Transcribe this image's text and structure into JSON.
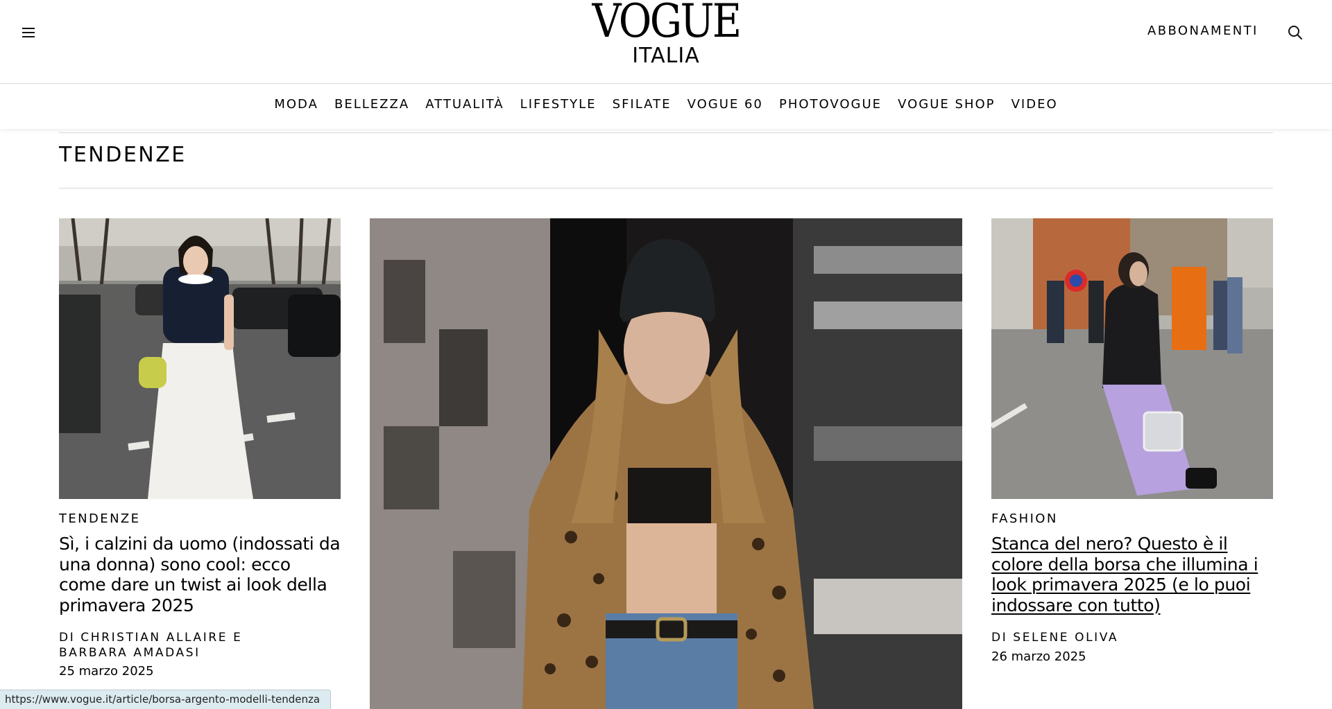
{
  "header": {
    "logo_primary": "VOGUE",
    "logo_secondary": "ITALIA",
    "subscribe_label": "ABBONAMENTI",
    "menu_icon": "hamburger-menu-icon",
    "search_icon": "search-icon"
  },
  "nav": {
    "items": [
      "MODA",
      "BELLEZZA",
      "ATTUALITÀ",
      "LIFESTYLE",
      "SFILATE",
      "VOGUE 60",
      "PHOTOVOGUE",
      "VOGUE SHOP",
      "VIDEO"
    ]
  },
  "section": {
    "title": "TENDENZE"
  },
  "cards": [
    {
      "rubric": "TENDENZE",
      "headline": "Sì, i calzini da uomo (indossati da una donna) sono cool: ecco come dare un twist ai look della primavera 2025",
      "byline": "DI CHRISTIAN ALLAIRE E BARBARA AMADASI",
      "date": "25 marzo 2025",
      "image": "street-style-photo-woman-white-skirt"
    },
    {
      "image": "runway-photo-model-leopard-coat"
    },
    {
      "rubric": "FASHION",
      "headline": "Stanca del nero? Questo è il colore della borsa che illumina i look primavera 2025 (e lo puoi indossare con tutto)",
      "byline": "DI SELENE OLIVA",
      "date": "26 marzo 2025",
      "image": "street-style-photo-woman-silver-bag"
    }
  ],
  "status_bar": {
    "url": "https://www.vogue.it/article/borsa-argento-modelli-tendenza"
  }
}
